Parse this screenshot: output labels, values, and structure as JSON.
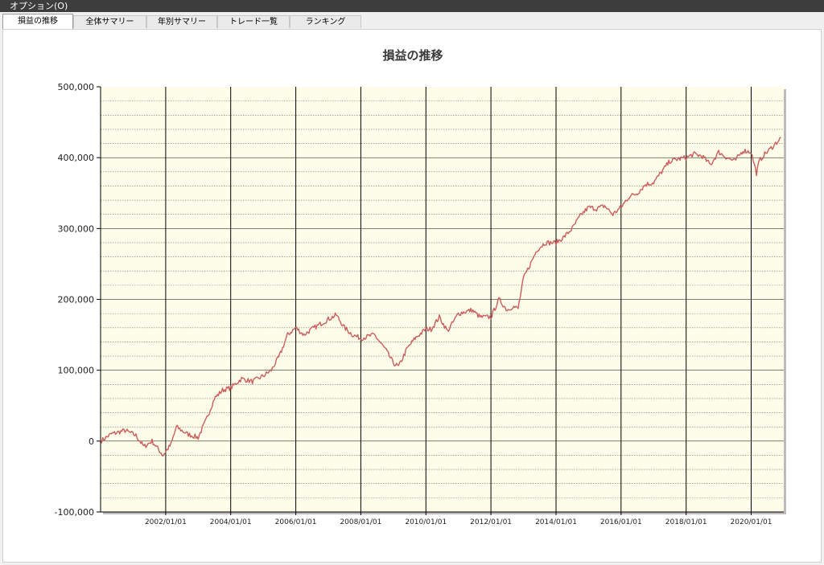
{
  "menubar": {
    "options_label": "オプション(O)"
  },
  "tabs": [
    {
      "label": "損益の推移",
      "active": true
    },
    {
      "label": "全体サマリー",
      "active": false
    },
    {
      "label": "年別サマリー",
      "active": false
    },
    {
      "label": "トレード一覧",
      "active": false
    },
    {
      "label": "ランキング",
      "active": false
    }
  ],
  "colors": {
    "plot_background": "#fdfde9",
    "series_line": "#cd5c5c",
    "major_grid": "#000000",
    "minor_grid": "#777777"
  },
  "chart_data": {
    "type": "line",
    "title": "損益の推移",
    "xlabel": "",
    "ylabel": "",
    "ylim": [
      -100000,
      500000
    ],
    "xlim": [
      "2000/01/01",
      "2021/01/01"
    ],
    "yticks": [
      "-100,000",
      "0",
      "100,000",
      "200,000",
      "300,000",
      "400,000",
      "500,000"
    ],
    "xticks": [
      "2002/01/01",
      "2004/01/01",
      "2006/01/01",
      "2008/01/01",
      "2010/01/01",
      "2012/01/01",
      "2014/01/01",
      "2016/01/01",
      "2018/01/01",
      "2020/01/01"
    ],
    "grid": true,
    "legend": "none",
    "series": [
      {
        "x": [
          "2000/01/01",
          "2000/05/01",
          "2000/10/01",
          "2001/02/01",
          "2001/05/01",
          "2001/08/01",
          "2001/10/01",
          "2001/12/01",
          "2002/03/01",
          "2002/05/01",
          "2002/09/01",
          "2003/01/01",
          "2003/04/01",
          "2003/07/01",
          "2003/10/01",
          "2004/01/01",
          "2004/05/01",
          "2004/09/01",
          "2005/01/01",
          "2005/04/01",
          "2005/07/01",
          "2005/10/01",
          "2006/01/01",
          "2006/04/01",
          "2006/07/01",
          "2006/10/01",
          "2007/01/01",
          "2007/04/01",
          "2007/07/01",
          "2007/10/01",
          "2008/01/01",
          "2008/06/01",
          "2008/10/01",
          "2009/01/01",
          "2009/03/01",
          "2009/06/01",
          "2009/09/01",
          "2010/01/01",
          "2010/03/01",
          "2010/06/01",
          "2010/09/01",
          "2011/01/01",
          "2011/06/01",
          "2011/09/01",
          "2012/01/01",
          "2012/04/01",
          "2012/07/01",
          "2012/09/01",
          "2012/11/01",
          "2013/01/01",
          "2013/03/01",
          "2013/06/01",
          "2013/09/01",
          "2014/01/01",
          "2014/04/01",
          "2014/07/01",
          "2014/10/01",
          "2015/01/01",
          "2015/04/01",
          "2015/07/01",
          "2015/10/01",
          "2016/01/01",
          "2016/04/01",
          "2016/07/01",
          "2016/10/01",
          "2017/01/01",
          "2017/04/01",
          "2017/07/01",
          "2017/10/01",
          "2018/01/01",
          "2018/04/01",
          "2018/07/01",
          "2018/10/01",
          "2019/01/01",
          "2019/04/01",
          "2019/07/01",
          "2019/10/01",
          "2020/01/01",
          "2020/03/01",
          "2020/04/01",
          "2020/06/01",
          "2020/08/01",
          "2020/10/01",
          "2020/12/01"
        ],
        "y": [
          0,
          10000,
          15000,
          8000,
          -8000,
          0,
          -10000,
          -20000,
          -5000,
          20000,
          10000,
          5000,
          30000,
          60000,
          72000,
          75000,
          88000,
          84000,
          92000,
          100000,
          120000,
          150000,
          160000,
          150000,
          158000,
          165000,
          172000,
          178000,
          160000,
          150000,
          145000,
          150000,
          130000,
          110000,
          105000,
          130000,
          145000,
          158000,
          158000,
          175000,
          155000,
          180000,
          185000,
          175000,
          175000,
          200000,
          185000,
          190000,
          187000,
          230000,
          245000,
          270000,
          280000,
          280000,
          288000,
          300000,
          318000,
          330000,
          328000,
          332000,
          320000,
          330000,
          345000,
          350000,
          362000,
          365000,
          380000,
          395000,
          398000,
          400000,
          405000,
          402000,
          390000,
          408000,
          400000,
          395000,
          410000,
          408000,
          378000,
          395000,
          405000,
          412000,
          420000,
          428000
        ]
      }
    ]
  }
}
